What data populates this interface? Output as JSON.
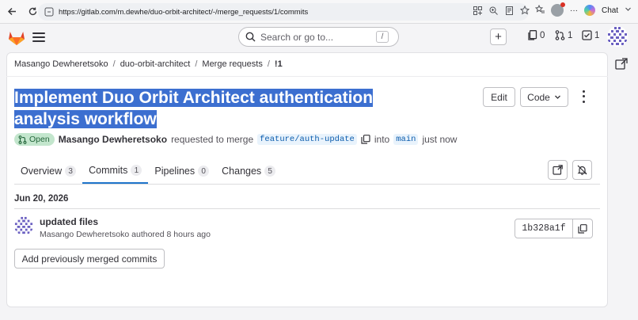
{
  "browser": {
    "url": "https://gitlab.com/m.dewhe/duo-orbit-architect/-/merge_requests/1/commits",
    "chat_label": "Chat",
    "more_label": "···"
  },
  "header": {
    "search_placeholder": "Search or go to...",
    "search_shortcut": "/",
    "issues_count": "0",
    "merge_requests_count": "1",
    "todos_count": "1"
  },
  "breadcrumb": {
    "items": [
      "Masango Dewheretsoko",
      "duo-orbit-architect",
      "Merge requests",
      "!1"
    ],
    "separator": "/"
  },
  "mr": {
    "title": "Implement Duo Orbit Architect authentication analysis workflow",
    "status": "Open",
    "author": "Masango Dewheretsoko",
    "action_text": "requested to merge",
    "source_branch": "feature/auth-update",
    "into_text": "into",
    "target_branch": "main",
    "time": "just now",
    "edit_label": "Edit",
    "code_label": "Code"
  },
  "tabs": [
    {
      "label": "Overview",
      "count": "3"
    },
    {
      "label": "Commits",
      "count": "1"
    },
    {
      "label": "Pipelines",
      "count": "0"
    },
    {
      "label": "Changes",
      "count": "5"
    }
  ],
  "commits": {
    "date": "Jun 20, 2026",
    "items": [
      {
        "title": "updated files",
        "author": "Masango Dewheretsoko",
        "authored_text": "authored 8 hours ago",
        "sha": "1b328a1f"
      }
    ],
    "add_button_label": "Add previously merged commits"
  },
  "colors": {
    "accent": "#1f75cb",
    "selection": "#3c6fd0",
    "open_badge_bg": "#c3e6cd",
    "tanuki_orange": "#e24329"
  }
}
